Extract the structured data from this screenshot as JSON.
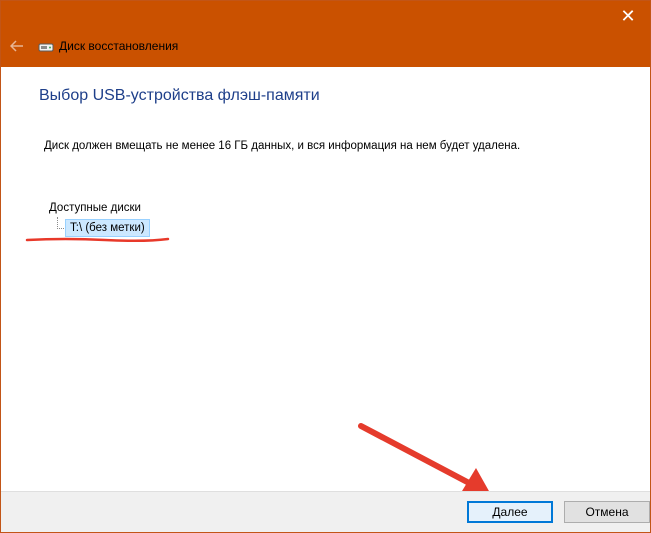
{
  "window": {
    "title": "Диск восстановления",
    "close_glyph": "✕"
  },
  "page": {
    "heading": "Выбор USB-устройства флэш-памяти",
    "instruction": "Диск должен вмещать не менее 16 ГБ данных, и вся информация на нем будет удалена."
  },
  "drives": {
    "root_label": "Доступные диски",
    "items": [
      {
        "label": "T:\\ (без метки)",
        "selected": true
      }
    ]
  },
  "buttons": {
    "next_label": "Далее",
    "cancel_label": "Отмена"
  },
  "colors": {
    "titlebar": "#ca5100",
    "heading": "#1e3f8a",
    "selection": "#cce8ff",
    "annotation": "#e8392a"
  },
  "icons": {
    "back": "back-arrow-icon",
    "title": "drive-icon",
    "close": "close-icon"
  }
}
